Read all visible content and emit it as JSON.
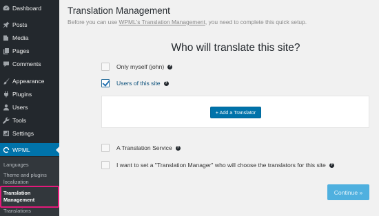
{
  "sidebar": {
    "items": [
      {
        "label": "Dashboard",
        "icon": "dashboard-icon"
      },
      {
        "label": "Posts",
        "icon": "pin-icon"
      },
      {
        "label": "Media",
        "icon": "media-icon"
      },
      {
        "label": "Pages",
        "icon": "pages-icon"
      },
      {
        "label": "Comments",
        "icon": "comment-icon"
      },
      {
        "label": "Appearance",
        "icon": "brush-icon"
      },
      {
        "label": "Plugins",
        "icon": "plugin-icon"
      },
      {
        "label": "Users",
        "icon": "user-icon"
      },
      {
        "label": "Tools",
        "icon": "wrench-icon"
      },
      {
        "label": "Settings",
        "icon": "settings-icon"
      },
      {
        "label": "WPML",
        "icon": "wpml-icon"
      }
    ],
    "submenu": {
      "languages": "Languages",
      "theme_line1": "Theme and plugins",
      "theme_line2": "localization",
      "tm_line1": "Translation",
      "tm_line2": "Management",
      "translations": "Translations"
    },
    "accent_color": "#0073aa",
    "highlight_color": "#e4197b"
  },
  "main": {
    "title": "Translation Management",
    "desc_before": "Before you can use ",
    "desc_link": "WPML's Translation Management",
    "desc_after": ", you need to complete this quick setup.",
    "question": "Who will translate this site?",
    "options": [
      {
        "label": "Only myself (john)",
        "checked": false
      },
      {
        "label": "Users of this site",
        "checked": true
      },
      {
        "label": "A Translation Service",
        "checked": false
      },
      {
        "label": "I want to set a \"Translation Manager\" who will choose the translators for this site",
        "checked": false
      }
    ],
    "help_glyph": "?",
    "add_translator_label": "+ Add a Translator",
    "continue_label": "Continue »"
  }
}
